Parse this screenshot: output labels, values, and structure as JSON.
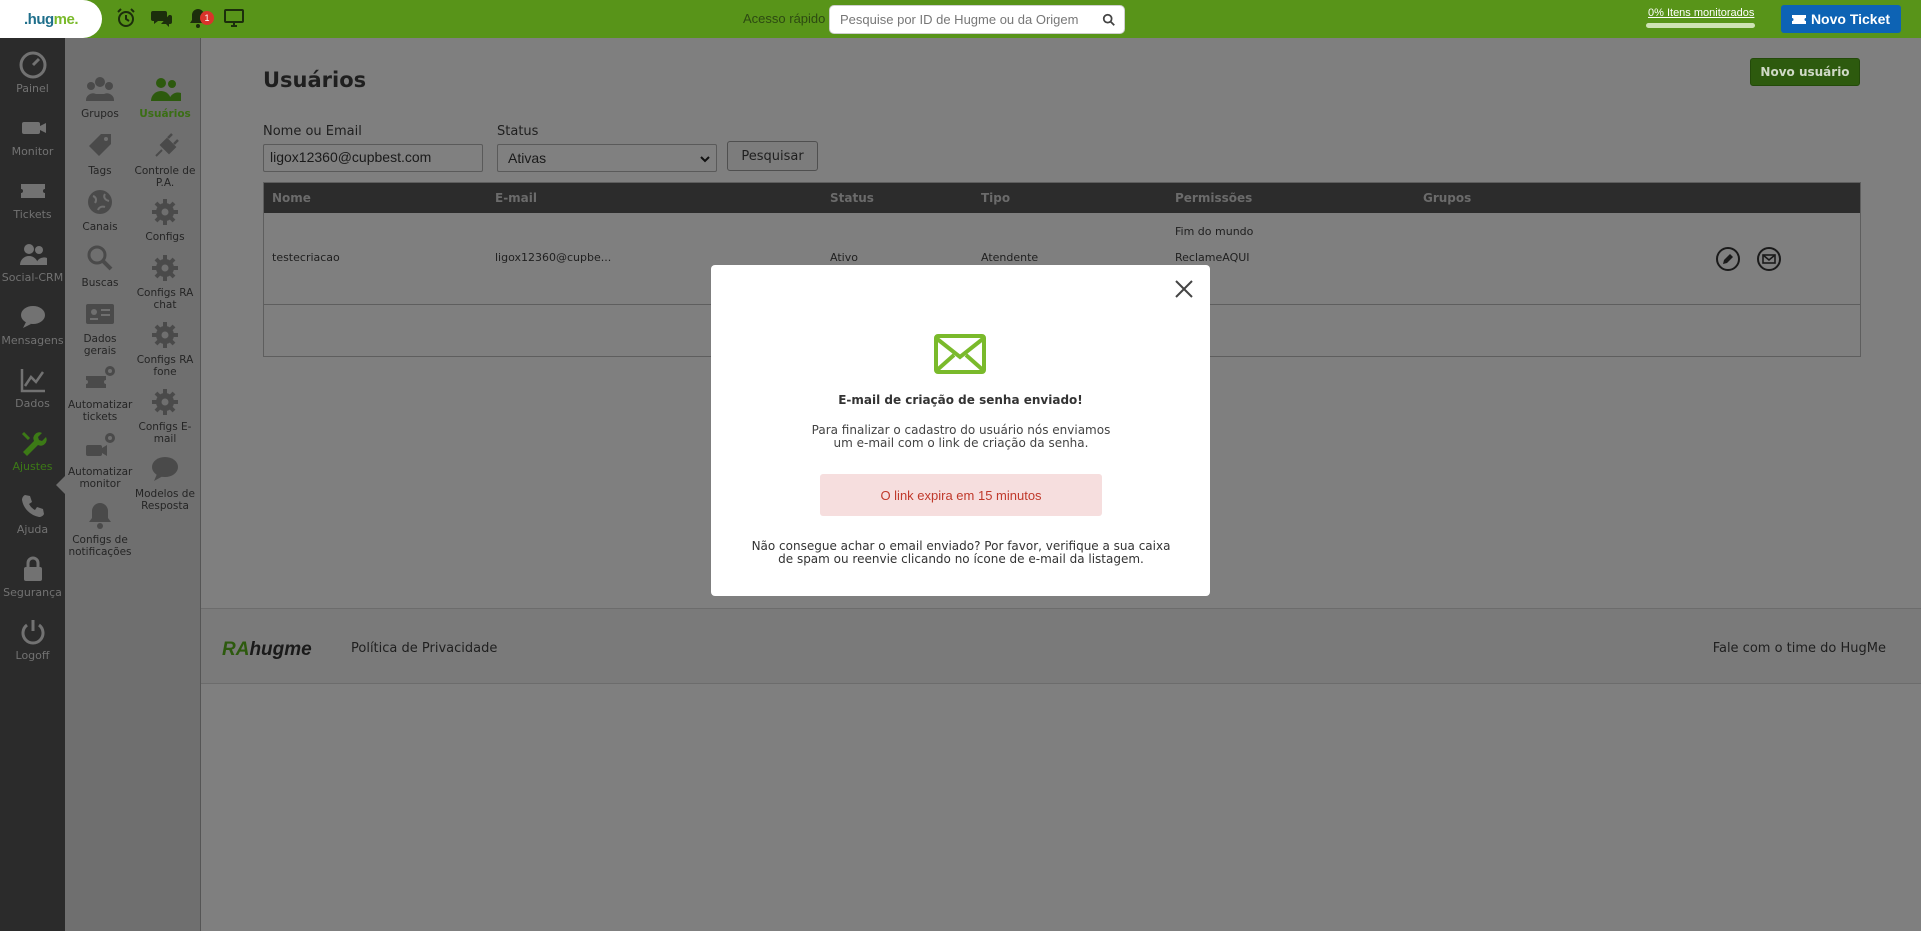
{
  "topbar": {
    "logo_hug": ".hug",
    "logo_me": "me.",
    "notif_count": "1",
    "quick_access_label": "Acesso rápido",
    "quick_search_placeholder": "Pesquise por ID de Hugme ou da Origem",
    "monitor_text": "0% Itens monitorados",
    "new_ticket_label": "Novo Ticket"
  },
  "sidebar": {
    "items": [
      {
        "label": "Painel",
        "icon": "dashboard-icon"
      },
      {
        "label": "Monitor",
        "icon": "camera-icon"
      },
      {
        "label": "Tickets",
        "icon": "ticket-icon"
      },
      {
        "label": "Social-CRM",
        "icon": "users-icon"
      },
      {
        "label": "Mensagens",
        "icon": "chat-icon"
      },
      {
        "label": "Dados",
        "icon": "chart-icon"
      },
      {
        "label": "Ajustes",
        "icon": "wrench-icon"
      },
      {
        "label": "Ajuda",
        "icon": "phone-icon"
      },
      {
        "label": "Segurança",
        "icon": "lock-icon"
      },
      {
        "label": "Logoff",
        "icon": "power-icon"
      }
    ],
    "active": "Ajustes"
  },
  "submenu": {
    "grupos": "Grupos",
    "usuarios": "Usuários",
    "tags": "Tags",
    "controle_pa": "Controle de P.A.",
    "canais": "Canais",
    "configs": "Configs",
    "buscas": "Buscas",
    "configs_ra_chat": "Configs RA chat",
    "dados_gerais": "Dados gerais",
    "configs_ra_fone": "Configs RA fone",
    "automatizar_tickets": "Automatizar tickets",
    "configs_email": "Configs E-mail",
    "automatizar_monitor": "Automatizar monitor",
    "modelos_resposta": "Modelos de Resposta",
    "configs_notificacoes": "Configs de notificações"
  },
  "main": {
    "title": "Usuários",
    "new_user_button": "Novo usuário",
    "filter_name_label": "Nome ou Email",
    "filter_name_value": "ligox12360@cupbest.com",
    "filter_status_label": "Status",
    "filter_status_value": "Ativas",
    "search_button": "Pesquisar",
    "table": {
      "headers": [
        "Nome",
        "E-mail",
        "Status",
        "Tipo",
        "Permissões",
        "Grupos"
      ],
      "rows": [
        {
          "nome": "testecriacao",
          "email": "ligox12360@cupbe...",
          "status": "Ativo",
          "tipo": "Atendente",
          "permissao_1": "Fim do mundo",
          "permissao_2": "ReclameAQUI"
        }
      ]
    }
  },
  "footer": {
    "logo_ra": "RA",
    "logo_hugme": "hugme",
    "privacy_link": "Política de Privacidade",
    "contact_link": "Fale com o time do HugMe"
  },
  "modal": {
    "title": "E-mail de criação de senha enviado!",
    "text": "Para finalizar o cadastro do usuário nós enviamos um e-mail com o link de criação da senha.",
    "expire_notice": "O link expira em 15 minutos",
    "help_text": "Não consegue achar o email enviado? Por favor, verifique a sua caixa de spam ou reenvie clicando no ícone de e-mail da listagem."
  },
  "colors": {
    "topbar_green": "#589419",
    "accent_green": "#7aba2b",
    "new_ticket_blue": "#0d63b4",
    "expire_red": "#c0392b",
    "expire_bg": "#f6dede"
  }
}
